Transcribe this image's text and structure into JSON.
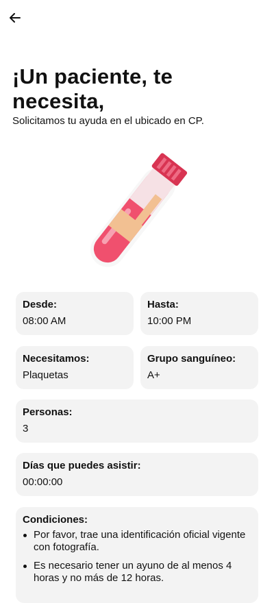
{
  "header": {
    "back_icon": "arrow-left-icon"
  },
  "hero": {
    "title": "¡Un paciente, te necesita,",
    "subtitle": "Solicitamos tu ayuda en el ubicado en CP.",
    "illustration": "blood-test-tube-icon",
    "colors": {
      "tube_red": "#f0506e",
      "cap_red": "#d83452",
      "bandage": "#f2c092"
    }
  },
  "details": {
    "from": {
      "label": "Desde:",
      "value": "08:00 AM"
    },
    "to": {
      "label": "Hasta:",
      "value": "10:00 PM"
    },
    "need": {
      "label": "Necesitamos:",
      "value": "Plaquetas"
    },
    "blood_group": {
      "label": "Grupo sanguíneo:",
      "value": "A+"
    },
    "people": {
      "label": "Personas:",
      "value": "3"
    },
    "days": {
      "label": "Días que puedes asistir:",
      "value": "00:00:00"
    },
    "conditions": {
      "label": "Condiciones:",
      "items": [
        "Por favor, trae una identificación oficial vigente con fotografía.",
        "Es necesario tener un ayuno de al menos 4 horas y no más de 12 horas."
      ]
    }
  },
  "colors": {
    "card_background": "#f3f3f3",
    "text": "#111111"
  }
}
